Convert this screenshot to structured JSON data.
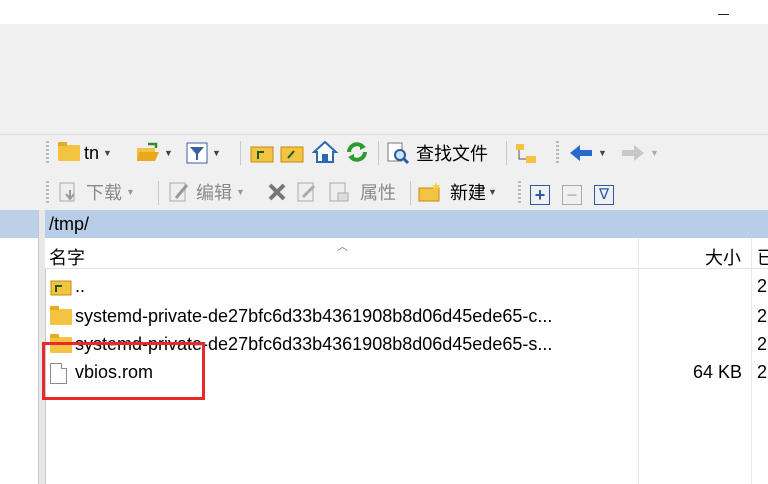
{
  "toolbar1": {
    "drive_label": "tn",
    "find_files_label": "查找文件"
  },
  "toolbar2": {
    "download_label": "下载",
    "edit_label": "编辑",
    "properties_label": "属性",
    "new_label": "新建",
    "plus_label": "+",
    "minus_label": "−",
    "check_label": "∇"
  },
  "path": "/tmp/",
  "columns": {
    "name": "名字",
    "size": "大小",
    "date_partial": "已"
  },
  "files": [
    {
      "name": "..",
      "size": "",
      "date_partial": "2",
      "type": "parent-folder"
    },
    {
      "name": "systemd-private-de27bfc6d33b4361908b8d06d45ede65-c...",
      "size": "",
      "date_partial": "2",
      "type": "folder"
    },
    {
      "name": "systemd-private-de27bfc6d33b4361908b8d06d45ede65-s...",
      "size": "",
      "date_partial": "2",
      "type": "folder"
    },
    {
      "name": "vbios.rom",
      "size": "64 KB",
      "date_partial": "2",
      "type": "file"
    }
  ],
  "colors": {
    "path_bar": "#b8cde6",
    "highlight": "#e8282b",
    "folder": "#f5c342"
  }
}
